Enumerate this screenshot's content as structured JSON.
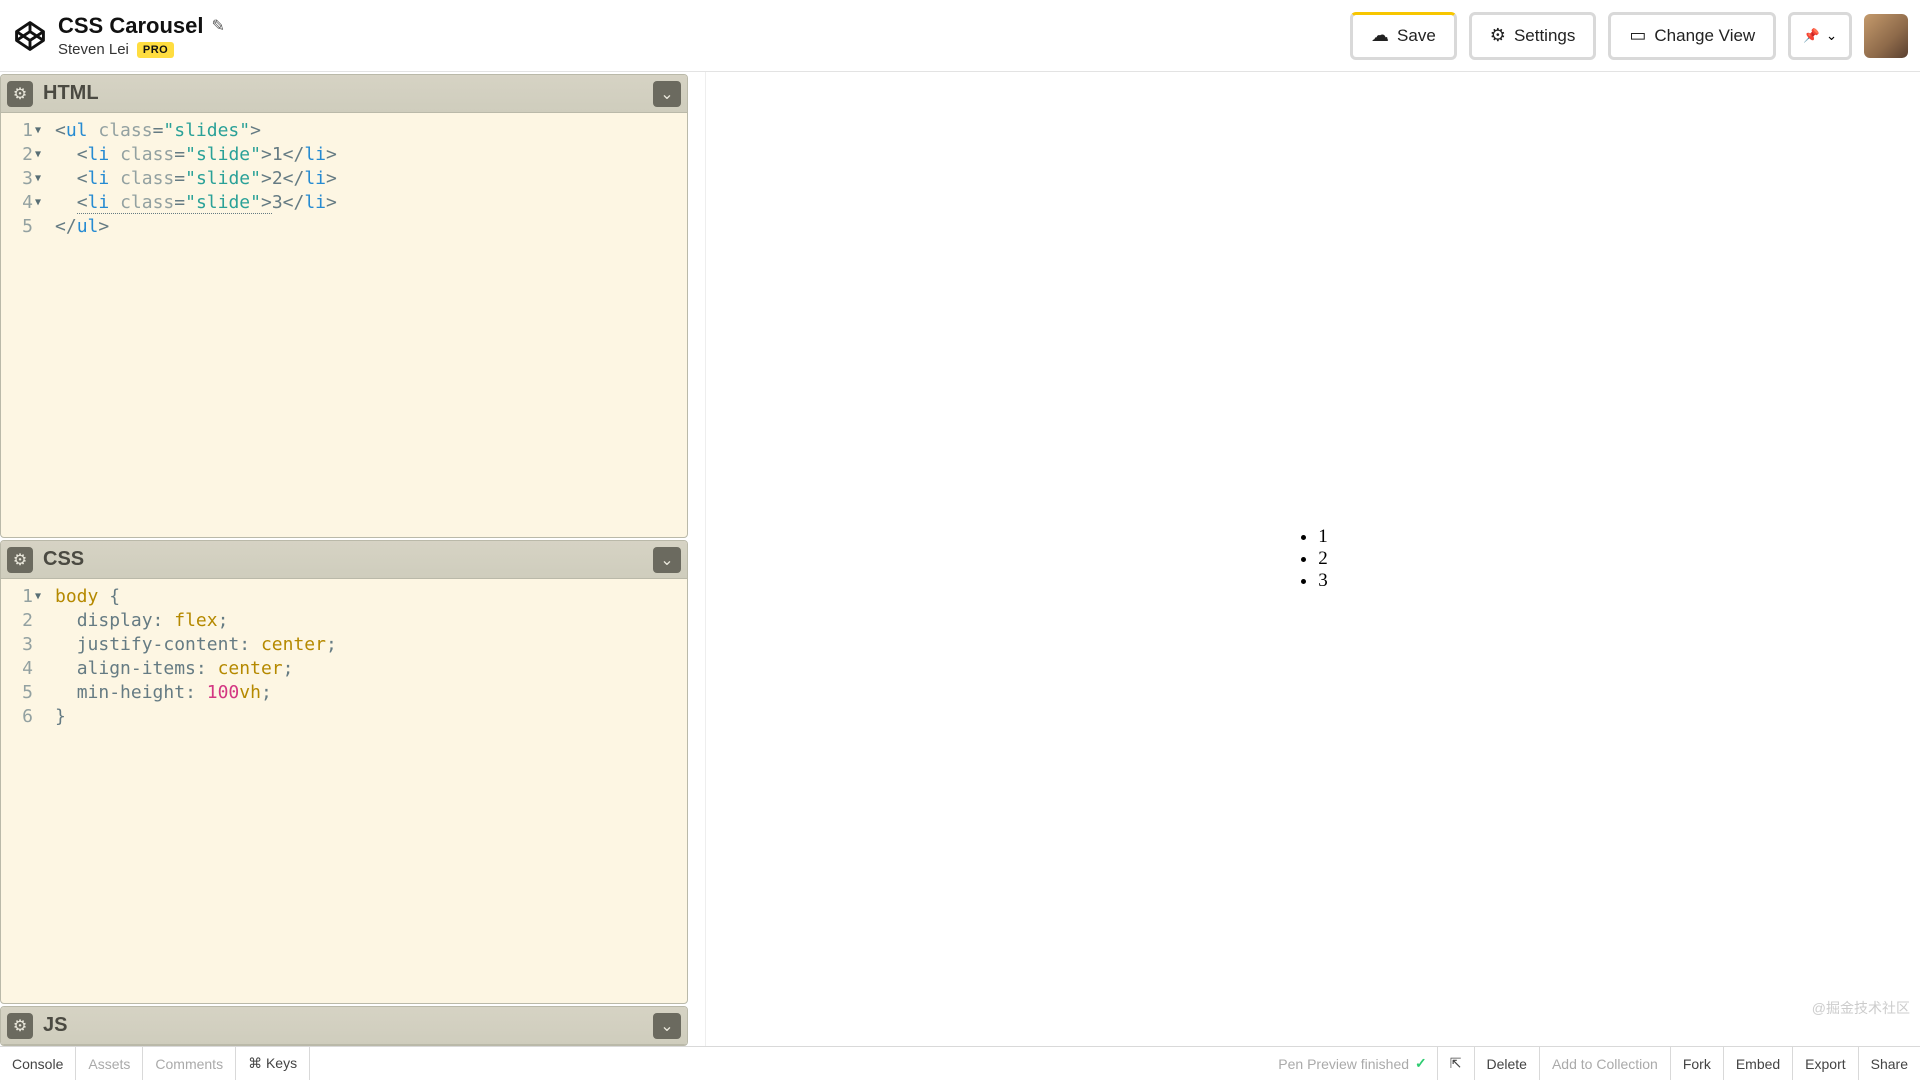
{
  "header": {
    "title": "CSS Carousel",
    "author": "Steven Lei",
    "pro_badge": "PRO",
    "buttons": {
      "save": "Save",
      "settings": "Settings",
      "change_view": "Change View"
    }
  },
  "panels": {
    "html": {
      "title": "HTML",
      "lines": [
        "1",
        "2",
        "3",
        "4",
        "5"
      ],
      "folds": [
        true,
        true,
        true,
        true,
        false
      ],
      "code": {
        "l1": {
          "open": "<",
          "tag": "ul",
          "sp": " ",
          "attr": "class",
          "eq": "=",
          "q1": "\"",
          "str": "slides",
          "q2": "\"",
          "close": ">"
        },
        "l2": {
          "indent": "  ",
          "open": "<",
          "tag": "li",
          "sp": " ",
          "attr": "class",
          "eq": "=",
          "q1": "\"",
          "str": "slide",
          "q2": "\"",
          "close": ">",
          "txt": "1",
          "copen": "</",
          "ctag": "li",
          "cclose": ">"
        },
        "l3": {
          "indent": "  ",
          "open": "<",
          "tag": "li",
          "sp": " ",
          "attr": "class",
          "eq": "=",
          "q1": "\"",
          "str": "slide",
          "q2": "\"",
          "close": ">",
          "txt": "2",
          "copen": "</",
          "ctag": "li",
          "cclose": ">"
        },
        "l4": {
          "indent": "  ",
          "open": "<",
          "tag": "li",
          "sp": " ",
          "attr": "class",
          "eq": "=",
          "q1": "\"",
          "str": "slide",
          "q2": "\"",
          "close": ">",
          "txt": "3",
          "copen": "</",
          "ctag": "li",
          "cclose": ">"
        },
        "l5": {
          "open": "</",
          "tag": "ul",
          "close": ">"
        }
      }
    },
    "css": {
      "title": "CSS",
      "lines": [
        "1",
        "2",
        "3",
        "4",
        "5",
        "6"
      ],
      "folds": [
        true,
        false,
        false,
        false,
        false,
        false
      ],
      "code": {
        "l1": {
          "sel": "body",
          "sp": " ",
          "brace": "{"
        },
        "l2": {
          "indent": "  ",
          "prop": "display",
          "colon": ":",
          "sp": " ",
          "val": "flex",
          "semi": ";"
        },
        "l3": {
          "indent": "  ",
          "prop": "justify-content",
          "colon": ":",
          "sp": " ",
          "val": "center",
          "semi": ";"
        },
        "l4": {
          "indent": "  ",
          "prop": "align-items",
          "colon": ":",
          "sp": " ",
          "val": "center",
          "semi": ";"
        },
        "l5": {
          "indent": "  ",
          "prop": "min-height",
          "colon": ":",
          "sp": " ",
          "num": "100",
          "unit": "vh",
          "semi": ";"
        },
        "l6": {
          "brace": "}"
        }
      }
    },
    "js": {
      "title": "JS"
    }
  },
  "preview": {
    "items": [
      "1",
      "2",
      "3"
    ]
  },
  "footer": {
    "left": [
      "Console",
      "Assets",
      "Comments",
      "⌘ Keys"
    ],
    "status": "Pen Preview finished",
    "right": [
      "Delete",
      "Add to Collection",
      "Fork",
      "Embed",
      "Export",
      "Share"
    ]
  },
  "watermark": "@掘金技术社区"
}
